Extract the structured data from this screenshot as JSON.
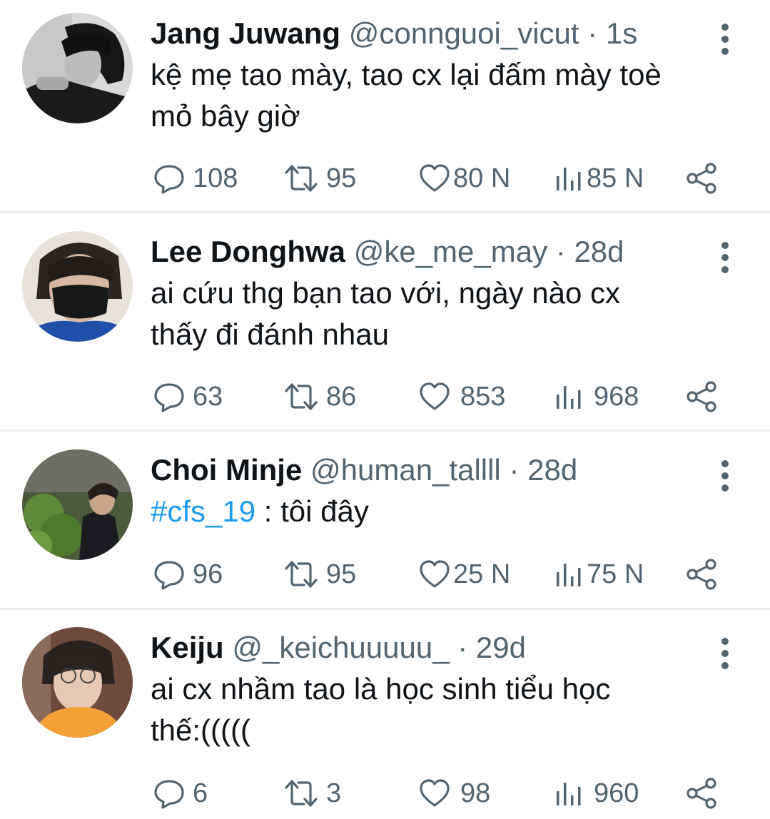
{
  "tweets": [
    {
      "name": "Jang Juwang",
      "handle": "@connguoi_vicut",
      "separator": "·",
      "time": "1s",
      "text_lines": [
        "kệ mẹ tao mày, tao cx lại đấm mày toè",
        "mỏ bây giờ"
      ],
      "replies": "108",
      "retweets": "95",
      "likes": "80 N",
      "views": "85 N"
    },
    {
      "name": "Lee Donghwa",
      "handle": "@ke_me_may",
      "separator": "·",
      "time": "28d",
      "text_lines": [
        "ai cứu thg bạn tao với, ngày nào cx",
        "thấy đi đánh nhau"
      ],
      "replies": "63",
      "retweets": "86",
      "likes": "853",
      "views": "968"
    },
    {
      "name": "Choi Minje",
      "handle": "@human_tallll",
      "separator": "·",
      "time": "28d",
      "hashtag": "#cfs_19",
      "text_after_hashtag": " : tôi đây",
      "replies": "96",
      "retweets": "95",
      "likes": "25 N",
      "views": "75 N"
    },
    {
      "name": "Keiju",
      "handle": "@_keichuuuuu_",
      "separator": "·",
      "time": "29d",
      "text_lines": [
        "ai cx nhầm tao là học sinh tiểu học",
        "thế:((((("
      ],
      "replies": "6",
      "retweets": "3",
      "likes": "98",
      "views": "960"
    }
  ],
  "colors": {
    "name": "#0f1419",
    "muted": "#536471",
    "hashtag": "#1d9bf0",
    "divider": "#eceff1"
  },
  "icons": {
    "reply": "comment-bubble-icon",
    "retweet": "retweet-arrows-icon",
    "like": "heart-icon",
    "views": "bar-chart-icon",
    "share": "share-nodes-icon",
    "more": "vertical-dots-icon"
  }
}
